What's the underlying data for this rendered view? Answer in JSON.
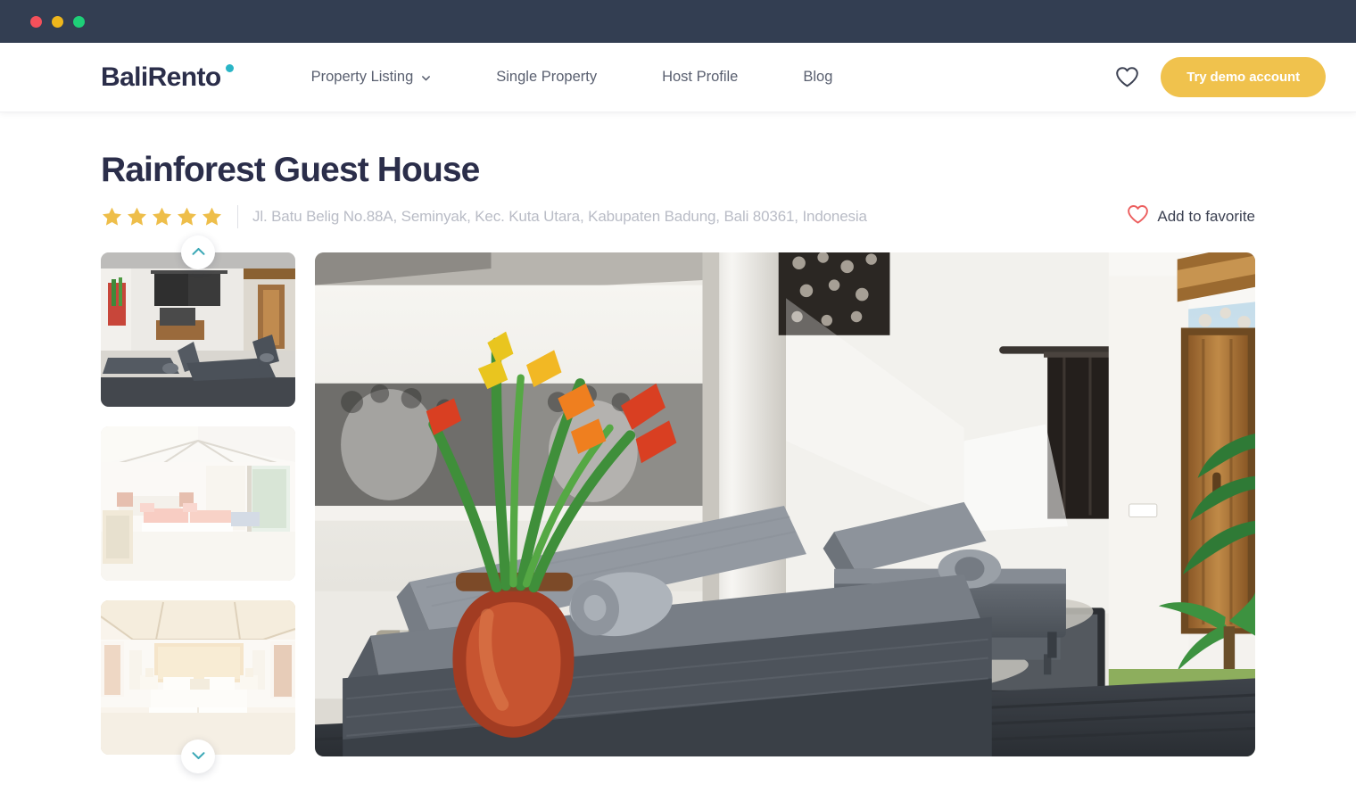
{
  "window": {
    "traffic_lights": [
      {
        "name": "close",
        "color": "#f4505b"
      },
      {
        "name": "minimize",
        "color": "#eeb61c"
      },
      {
        "name": "maximize",
        "color": "#1ecf78"
      }
    ]
  },
  "header": {
    "logo_text": "BaliRento",
    "logo_dot_color": "#2ab5c6",
    "nav": [
      {
        "label": "Property Listing",
        "has_dropdown": true,
        "icon": "chevron-down-icon"
      },
      {
        "label": "Single Property",
        "has_dropdown": false
      },
      {
        "label": "Host Profile",
        "has_dropdown": false
      },
      {
        "label": "Blog",
        "has_dropdown": false
      }
    ],
    "wishlist_icon": "heart-icon",
    "cta_label": "Try demo account",
    "cta_color": "#f0c24d"
  },
  "property": {
    "title": "Rainforest Guest House",
    "rating": 5,
    "rating_max": 5,
    "star_color": "#eebe4a",
    "address": "Jl. Batu Belig No.88A, Seminyak, Kec. Kuta Utara, Kabupaten Badung, Bali 80361, Indonesia",
    "favorite": {
      "label": "Add to favorite",
      "icon": "heart-outline-icon",
      "icon_color": "#ec5f5f",
      "active": false
    }
  },
  "gallery": {
    "scroll_up_icon": "chevron-up-icon",
    "scroll_down_icon": "chevron-down-icon",
    "arrow_color": "#3ba8b6",
    "active_index": 0,
    "thumbnails": [
      {
        "name": "thumb-terrace-loungers",
        "alt": "Outdoor terrace with grey sun loungers",
        "active": true
      },
      {
        "name": "thumb-twin-bedroom",
        "alt": "Bright twin bedroom with coral bedding",
        "active": false
      },
      {
        "name": "thumb-master-bedroom",
        "alt": "Master bedroom with bamboo ceiling",
        "active": false
      }
    ],
    "hero": {
      "name": "hero-terrace-loungers",
      "alt": "Villa terrace with white walls, wooden doors, tropical plant and grey sun loungers on a deck"
    }
  }
}
